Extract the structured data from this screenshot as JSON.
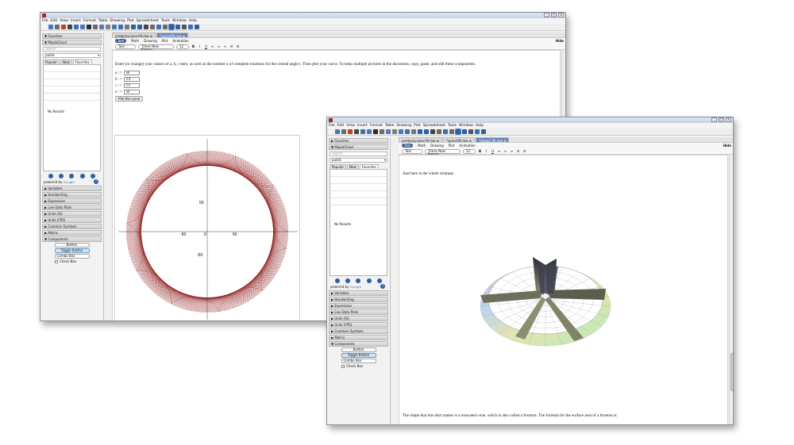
{
  "menu": [
    "File",
    "Edit",
    "View",
    "Insert",
    "Format",
    "Table",
    "Drawing",
    "Plot",
    "Spreadsheet",
    "Tools",
    "Window",
    "Help"
  ],
  "w1": {
    "tabs": [
      "predprey-java-fill.mw",
      "*spiro1fill.mw"
    ],
    "modes": [
      "Text",
      "Math",
      "Drawing",
      "Plot",
      "Animation"
    ],
    "hide": "Hide",
    "style": "Text",
    "font": "Times New Roman",
    "size": "12",
    "instruction": "Enter (or change) your values of a, b, c here, as well as the number n of complete rotations for the central angle t.  Then plot your curve.  To keep multiple pictures in the document, copy, paste, and edit these components.",
    "params": [
      {
        "label": "a :=",
        "value": "60"
      },
      {
        "label": "b :=",
        "value": "5.8"
      },
      {
        "label": "c :=",
        "value": "5.5"
      },
      {
        "label": "n :=",
        "value": "30"
      }
    ],
    "plot_button": "Plot the curve",
    "axis_ticks": {
      "x_neg": "-50",
      "x_zero": "0",
      "x_pos": "50",
      "y_pos": "50",
      "y_neg": "-50"
    }
  },
  "w2": {
    "tabs": [
      "predprey-java-fill.mw",
      "*spiro1fill.mw",
      "*skew2_fill.mw"
    ],
    "modes": [
      "Text",
      "Math",
      "Drawing",
      "Plot",
      "Animation"
    ],
    "hide": "Hide",
    "style": "Text",
    "font": "Times New Roman",
    "size": "12",
    "intro": "And here is the whole schmear.",
    "footer_text": "The shape that this skirt makes is a truncated cone, which is also called a frustum.  The formula for the surface area of a frustum is:"
  },
  "palette": {
    "favorites": "Favorites",
    "maplecloud": "MapleCloud",
    "search_placeholder": "Search",
    "combo": "public",
    "tabs": [
      "Popular",
      "New",
      "Favorites"
    ],
    "no_results": "No Results",
    "powered_by": "powered by",
    "google": "Google",
    "sections": [
      "Variables",
      "Handwriting",
      "Expression",
      "Live Data Plots",
      "Units (SI)",
      "Units (FPS)",
      "Common Symbols",
      "Matrix"
    ],
    "components": "Components",
    "comp_button": "Button",
    "comp_toggle": "Toggle Button",
    "comp_combo": "Combo Box",
    "comp_check": "Check Box"
  },
  "colors": {
    "curve": "#8e1b1b",
    "accent": "#3f5f96"
  }
}
